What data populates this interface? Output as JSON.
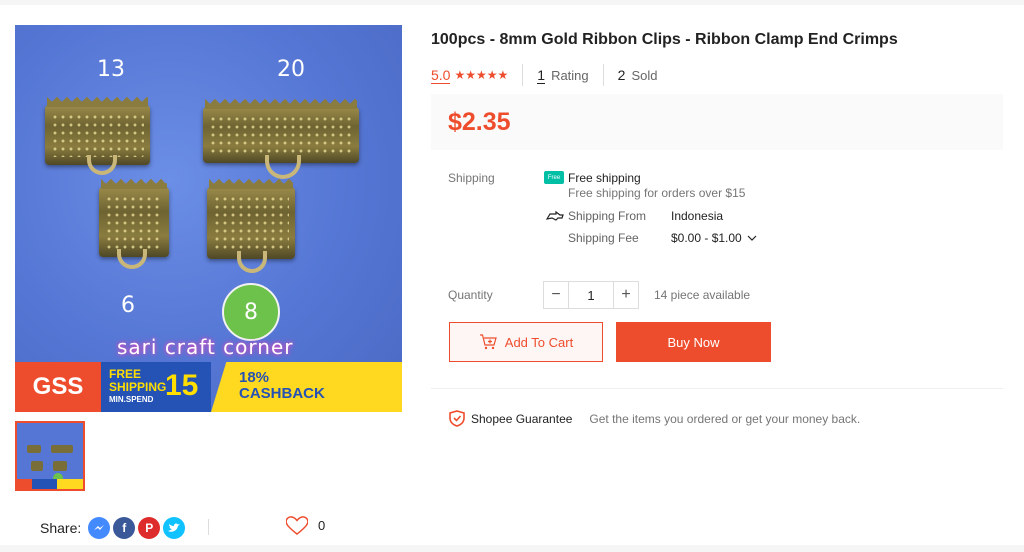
{
  "product": {
    "title": "100pcs - 8mm Gold Ribbon Clips - Ribbon Clamp End Crimps",
    "rating": "5.0",
    "stars": "★★★★★",
    "rating_count": "1",
    "rating_label": "Rating",
    "sold_count": "2",
    "sold_label": "Sold",
    "price": "$2.35"
  },
  "image": {
    "size_labels": [
      "13",
      "20",
      "6",
      "8"
    ],
    "watermark": "sari craft corner",
    "banner": {
      "gss": "GSS",
      "free_shipping": "FREE SHIPPING",
      "min_spend": "MIN.SPEND",
      "amount": "15",
      "cashback": "18% CASHBACK"
    }
  },
  "shipping": {
    "label": "Shipping",
    "free_badge": "Free",
    "free_title": "Free shipping",
    "free_sub": "Free shipping for orders over $15",
    "from_label": "Shipping From",
    "from_value": "Indonesia",
    "fee_label": "Shipping Fee",
    "fee_value": "$0.00 - $1.00"
  },
  "quantity": {
    "label": "Quantity",
    "minus": "−",
    "value": "1",
    "plus": "+",
    "available": "14 piece available"
  },
  "actions": {
    "add_to_cart": "Add To Cart",
    "buy_now": "Buy Now"
  },
  "guarantee": {
    "name": "Shopee Guarantee",
    "text": "Get the items you ordered or get your money back."
  },
  "share": {
    "label": "Share:",
    "like_count": "0"
  },
  "colors": {
    "accent": "#ee4d2d",
    "messenger": "#448aff",
    "facebook": "#3b5999",
    "pinterest": "#de2c2c",
    "twitter": "#10c2ff"
  }
}
